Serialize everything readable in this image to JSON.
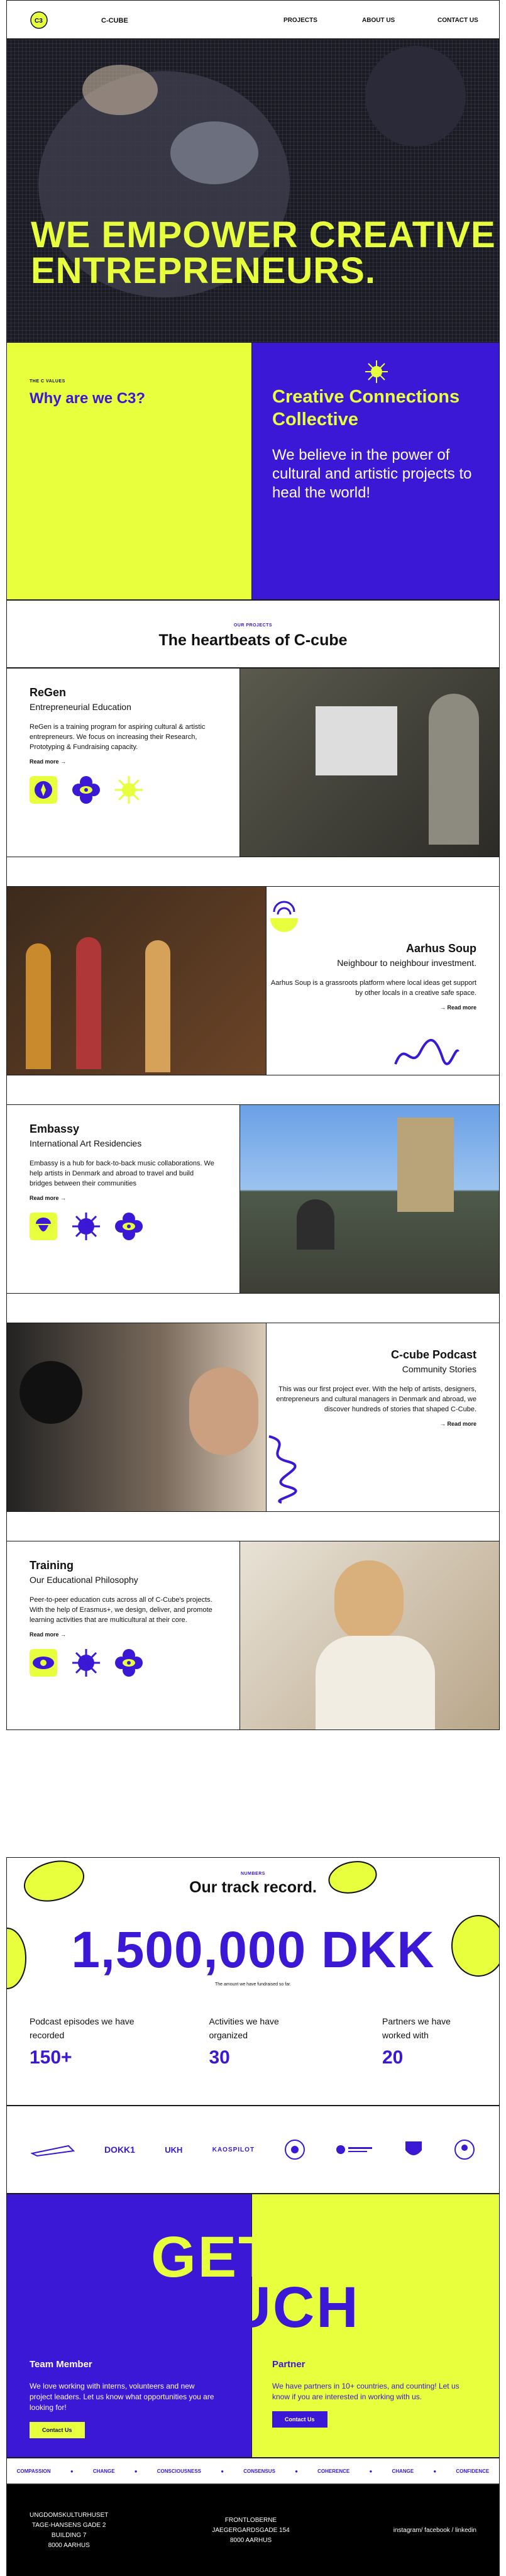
{
  "nav": {
    "brand": "C-CUBE",
    "links": [
      "PROJECTS",
      "ABOUT US",
      "CONTACT US"
    ]
  },
  "hero": {
    "headline": "WE EMPOWER CREATIVE ENTREPRENEURS."
  },
  "values": {
    "eyebrow": "THE C VALUES",
    "title": "Why are we C3?",
    "right_title": "Creative Connections Collective",
    "right_text": "We believe in the power of cultural and artistic projects to heal the world!"
  },
  "beats": {
    "eyebrow": "OUR PROJECTS",
    "title": "The heartbeats of C-cube"
  },
  "projects": [
    {
      "title": "ReGen",
      "sub": "Entrepreneurial Education",
      "text": "ReGen is a training program for aspiring cultural & artistic entrepreneurs. We focus on increasing their Research, Prototyping & Fundraising capacity.",
      "more": "Read more →"
    },
    {
      "title": "Aarhus Soup",
      "sub": "Neighbour to neighbour investment.",
      "text": "Aarhus Soup is a grassroots platform where local ideas get support by other locals in a creative safe space.",
      "more": "→ Read more"
    },
    {
      "title": "Embassy",
      "sub": "International Art Residencies",
      "text": "Embassy is a hub for back-to-back music collaborations. We help artists in Denmark and abroad to travel and build bridges between their communities",
      "more": "Read more →"
    },
    {
      "title": "C-cube Podcast",
      "sub": "Community Stories",
      "text": "This was our first project ever. With the help of artists, designers, entrepreneurs and cultural managers in Denmark and abroad, we discover hundreds of stories that shaped C-Cube.",
      "more": "→ Read more"
    },
    {
      "title": "Training",
      "sub": "Our Educational Philosophy",
      "text": "Peer-to-peer education cuts across all of C-Cube's projects. With the help of Erasmus+, we design, deliver, and promote learning activities that are multicultural at their core.",
      "more": "Read more →"
    }
  ],
  "stats": {
    "eyebrow": "NUMBERS",
    "title": "Our track record.",
    "amount": "1,500,000 DKK",
    "amount_note": "The amount we have fundraised so far.",
    "items": [
      {
        "label": "Podcast episodes we have recorded",
        "value": "150+"
      },
      {
        "label": "Activities we have organized",
        "value": "30"
      },
      {
        "label": "Partners we have worked with",
        "value": "20"
      }
    ]
  },
  "partners": [
    "DOKK1",
    "UKH",
    "KAOSPILOT"
  ],
  "contact": {
    "headline1": "GET IN",
    "headline2": "TOUCH",
    "team_title": "Team Member",
    "team_text": "We love working with interns, volunteers and new project leaders. Let us know what opportunities you are looking for!",
    "team_btn": "Contact Us",
    "partner_title": "Partner",
    "partner_text": "We have partners in 10+ countries, and counting! Let us know if you are interested in working with us.",
    "partner_btn": "Contact Us"
  },
  "ticker": [
    "COMPASSION",
    "CHANGE",
    "CONSCIOUSNESS",
    "CONSENSUS",
    "COHERENCE",
    "CHANGE",
    "CONFIDENCE"
  ],
  "footer": {
    "addr1": [
      "UNGDOMSKULTURHUSET",
      "TAGE-HANSENS GADE 2",
      "BUILDING 7",
      "8000 AARHUS"
    ],
    "addr2": [
      "FRONTLOBERNE",
      "JAEGERGARDSGADE 154",
      "8000 AARHUS"
    ],
    "social": "instagram/ facebook / linkedin"
  },
  "colors": {
    "yellow": "#e7ff3d",
    "blue": "#3a18d6"
  }
}
